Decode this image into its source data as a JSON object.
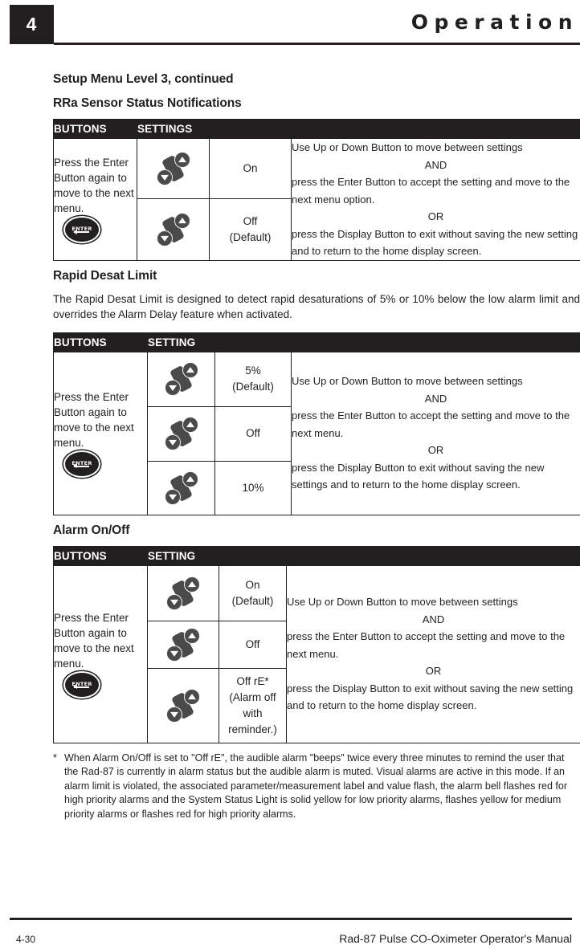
{
  "header": {
    "chapter_number": "4",
    "title": "Operation"
  },
  "content": {
    "section_title": "Setup Menu Level 3, continued",
    "sections": [
      {
        "heading": "RRa Sensor Status Notifications",
        "intro": "",
        "table": {
          "col_headers": {
            "buttons": "BUTTONS",
            "settings": "SETTINGS"
          },
          "buttons_text": "Press the Enter Button again to move to the next menu.",
          "buttons_icon": "enter-button-icon",
          "rows": [
            {
              "icon": "up-down-button-icon",
              "setting": "On",
              "note": ""
            },
            {
              "icon": "up-down-button-icon",
              "setting": "Off",
              "note": "(Default)"
            }
          ],
          "instructions": [
            {
              "text": "Use Up or Down Button to move between settings",
              "align": "left"
            },
            {
              "text": "AND",
              "align": "center"
            },
            {
              "text": "press the Enter Button to accept the setting and move to the next menu option.",
              "align": "left"
            },
            {
              "text": "OR",
              "align": "center"
            },
            {
              "text": "press the Display Button to exit without saving the new setting and to return to the home display screen.",
              "align": "left"
            }
          ]
        }
      },
      {
        "heading": "Rapid Desat Limit",
        "intro": "The Rapid Desat Limit is designed to detect rapid desaturations of 5% or 10% below the low alarm limit and overrides the Alarm Delay feature when activated.",
        "table": {
          "col_headers": {
            "buttons": "BUTTONS",
            "settings": "SETTING"
          },
          "buttons_text": "Press the Enter Button again to move to the next menu.",
          "buttons_icon": "enter-button-icon",
          "rows": [
            {
              "icon": "up-down-button-icon",
              "setting": "5%",
              "note": "(Default)"
            },
            {
              "icon": "up-down-button-icon",
              "setting": "Off",
              "note": ""
            },
            {
              "icon": "up-down-button-icon",
              "setting": "10%",
              "note": ""
            }
          ],
          "instructions": [
            {
              "text": "Use Up or Down Button to move between settings",
              "align": "left"
            },
            {
              "text": "AND",
              "align": "center"
            },
            {
              "text": "press the Enter Button to accept the setting and move to the next menu.",
              "align": "left"
            },
            {
              "text": "OR",
              "align": "center"
            },
            {
              "text": "press the Display Button to exit without saving the new settings and to return to the home display screen.",
              "align": "left"
            }
          ]
        }
      },
      {
        "heading": "Alarm On/Off",
        "intro": "",
        "table": {
          "col_headers": {
            "buttons": "BUTTONS",
            "settings": "SETTING"
          },
          "buttons_text": "Press the Enter Button again to move to the next menu.",
          "buttons_icon": "enter-button-icon",
          "rows": [
            {
              "icon": "up-down-button-icon",
              "setting": "On",
              "note": "(Default)"
            },
            {
              "icon": "up-down-button-icon",
              "setting": "Off",
              "note": ""
            },
            {
              "icon": "up-down-button-icon",
              "setting": "Off rE*",
              "note": "(Alarm off with reminder.)"
            }
          ],
          "instructions": [
            {
              "text": "Use Up or Down Button to move between settings",
              "align": "left"
            },
            {
              "text": "AND",
              "align": "center"
            },
            {
              "text": "press the Enter Button to accept the setting and move to the next menu.",
              "align": "left"
            },
            {
              "text": "OR",
              "align": "center"
            },
            {
              "text": "press the Display Button to exit without saving the new setting and to return to the home display screen.",
              "align": "left"
            }
          ]
        }
      }
    ],
    "footnote": {
      "marker": "*",
      "text": "When Alarm On/Off is set to \"Off rE\", the audible alarm \"beeps\" twice every three minutes to remind the user that the Rad-87 is currently in alarm status but the audible alarm is muted. Visual alarms are active in this mode. If an alarm limit is violated, the associated parameter/measurement label and value flash, the alarm bell flashes red for high priority alarms and the System Status Light is solid yellow for low priority alarms, flashes yellow for medium priority alarms or flashes red for high priority alarms."
    }
  },
  "footer": {
    "page_number": "4-30",
    "manual_title": "Rad-87 Pulse CO-Oximeter Operator's Manual"
  },
  "colors": {
    "ink": "#231f20",
    "icon_gray": "#4a4a4a",
    "page": "#ffffff"
  }
}
